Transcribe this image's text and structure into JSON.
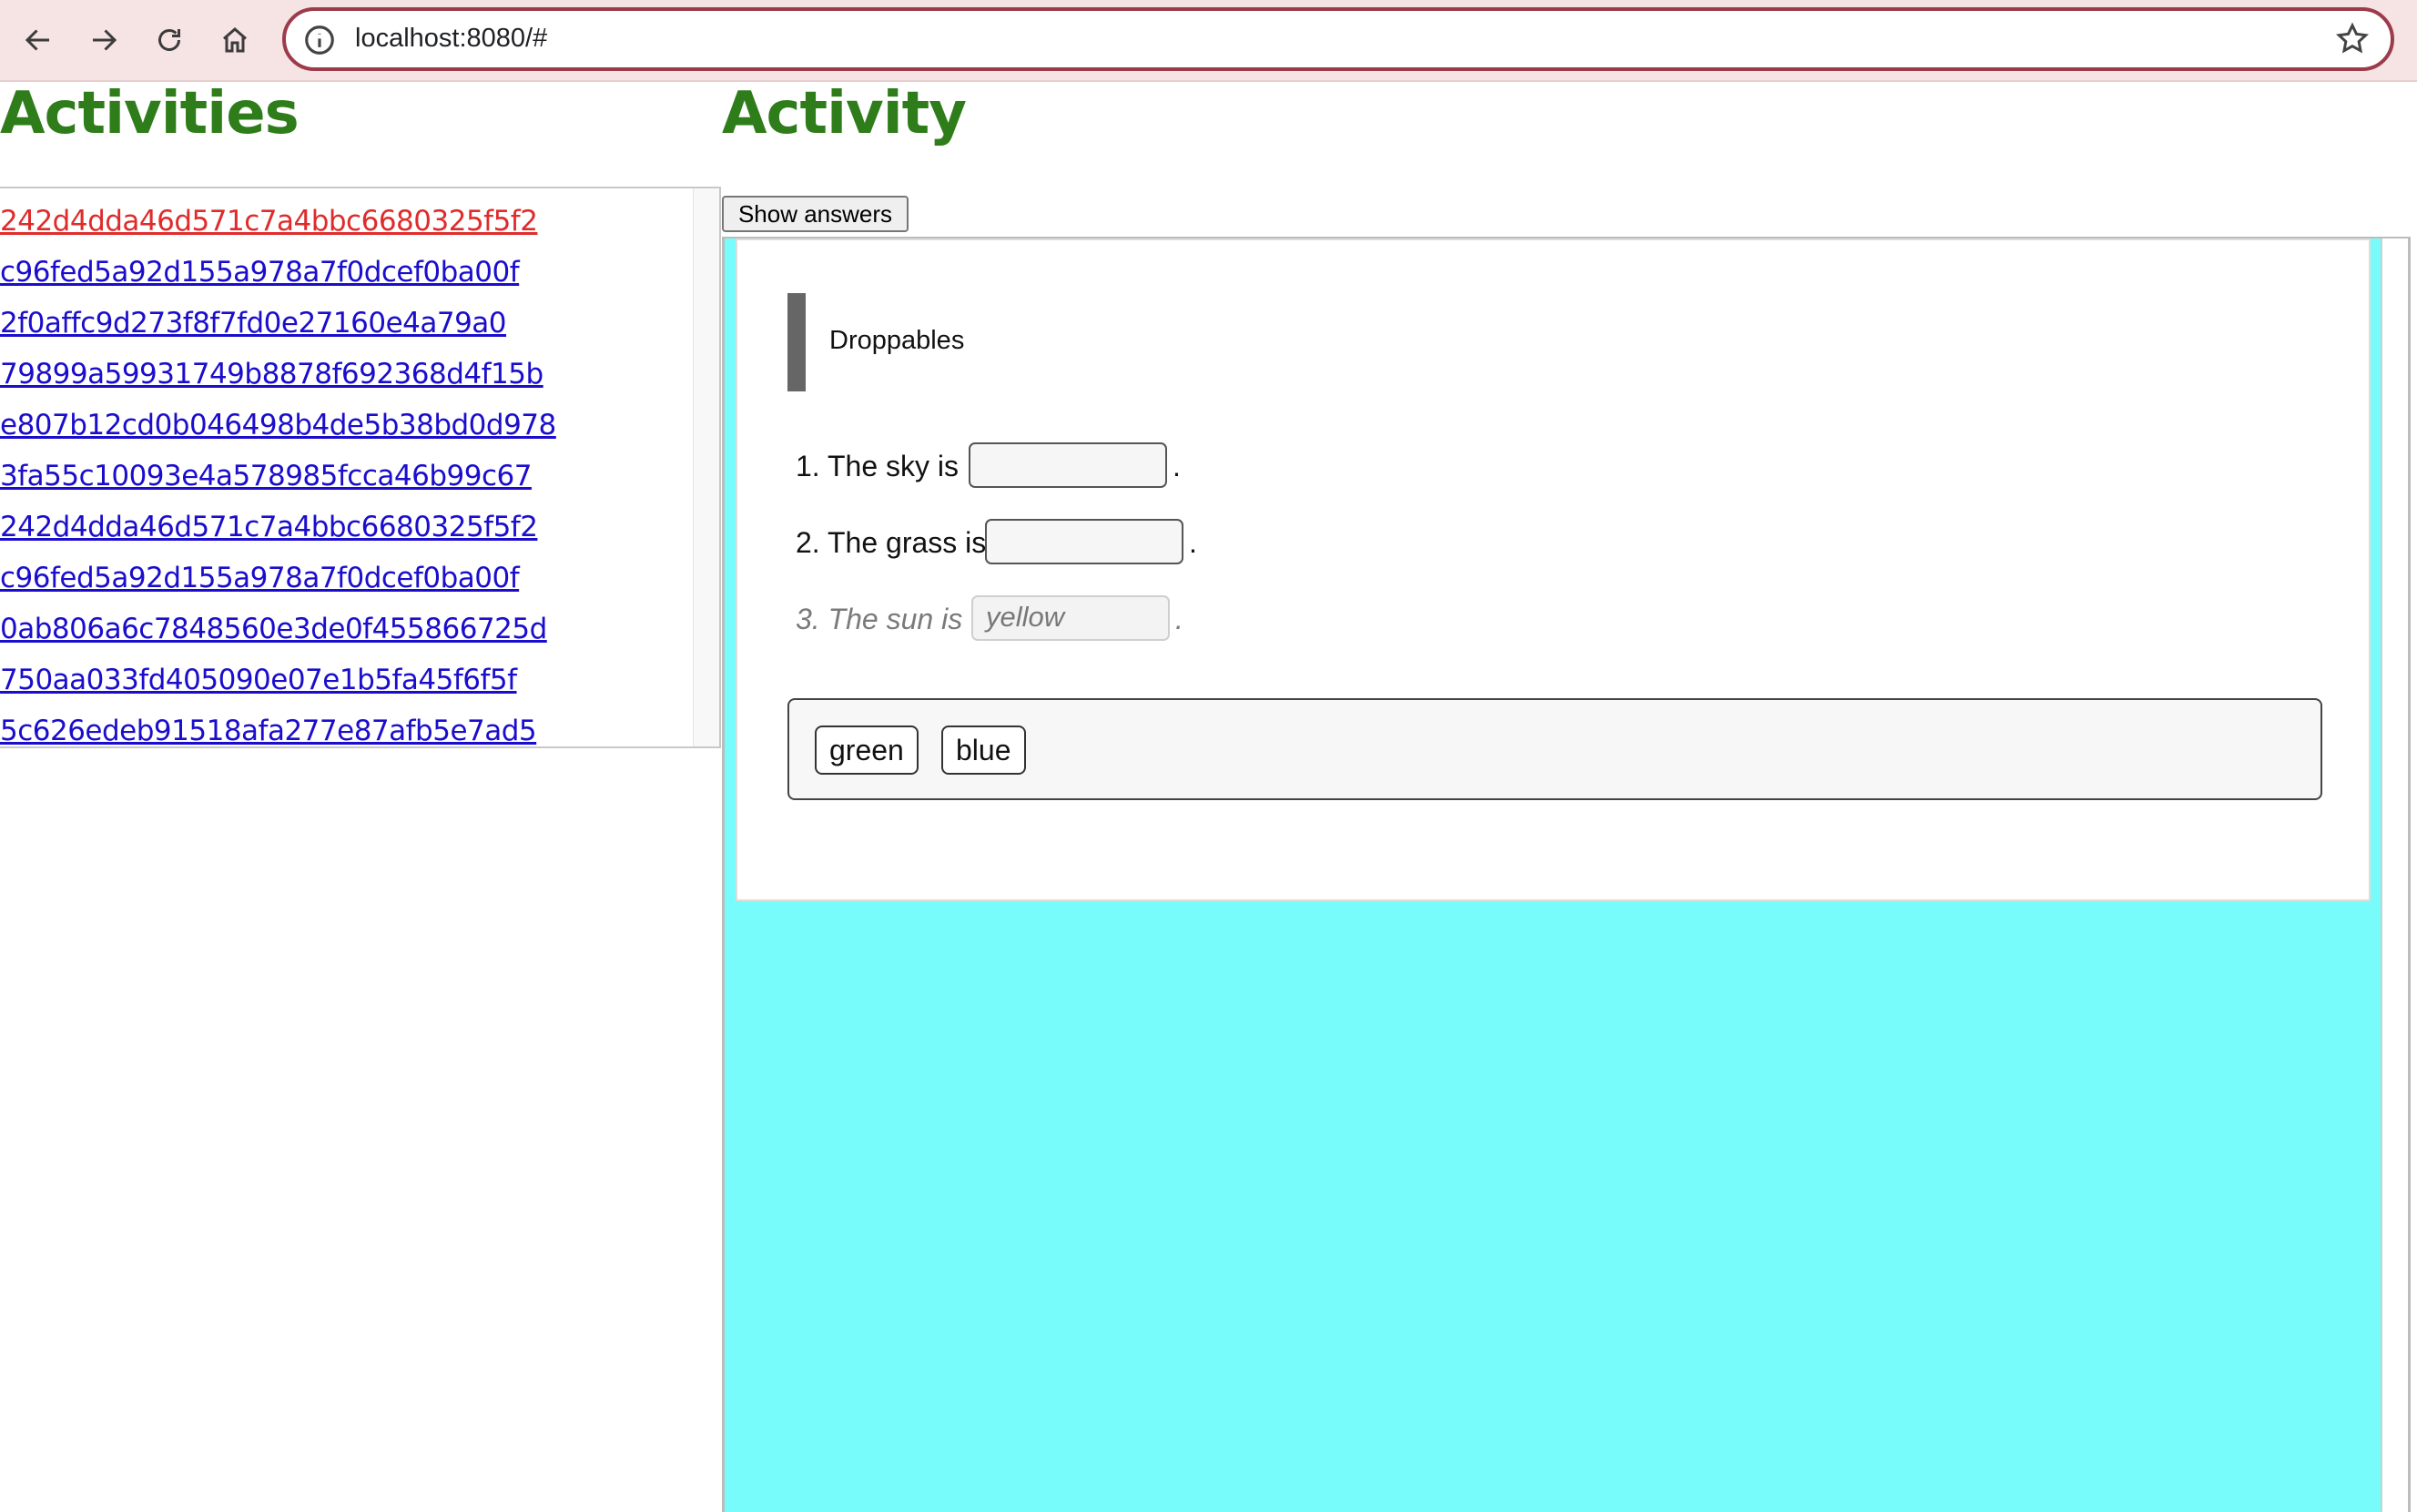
{
  "browser": {
    "url": "localhost:8080/#"
  },
  "activities": {
    "title": "Activities",
    "items": [
      {
        "id": "242d4dda46d571c7a4bbc6680325f5f2",
        "active": true
      },
      {
        "id": "c96fed5a92d155a978a7f0dcef0ba00f",
        "active": false
      },
      {
        "id": "2f0affc9d273f8f7fd0e27160e4a79a0",
        "active": false
      },
      {
        "id": "79899a59931749b8878f692368d4f15b",
        "active": false
      },
      {
        "id": "e807b12cd0b046498b4de5b38bd0d978",
        "active": false
      },
      {
        "id": "3fa55c10093e4a578985fcca46b99c67",
        "active": false
      },
      {
        "id": "242d4dda46d571c7a4bbc6680325f5f2",
        "active": false
      },
      {
        "id": "c96fed5a92d155a978a7f0dcef0ba00f",
        "active": false
      },
      {
        "id": "0ab806a6c7848560e3de0f455866725d",
        "active": false
      },
      {
        "id": "750aa033fd405090e07e1b5fa45f6f5f",
        "active": false
      },
      {
        "id": "5c626edeb91518afa277e87afb5e7ad5",
        "active": false
      }
    ]
  },
  "activity": {
    "title": "Activity",
    "show_answers_label": "Show answers",
    "card_title": "Droppables",
    "questions": [
      {
        "text": "1. The sky is",
        "answer": "",
        "end": "."
      },
      {
        "text": "2. The grass is",
        "answer": "",
        "end": "."
      },
      {
        "text": "3. The sun is",
        "answer": "yellow",
        "end": "."
      }
    ],
    "bank": [
      "green",
      "blue"
    ]
  },
  "colors": {
    "heading": "#2e7d1a",
    "link": "#1a0dcc",
    "link_active": "#e02b2b",
    "frame_bg": "#77fbfb"
  }
}
